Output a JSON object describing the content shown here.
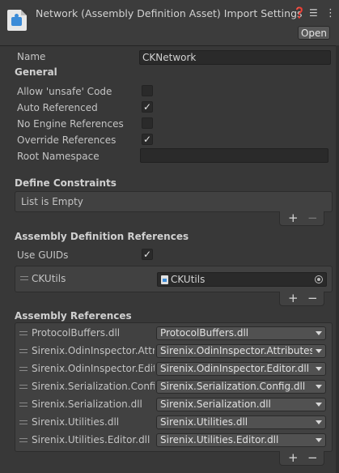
{
  "header": {
    "title": "Network (Assembly Definition Asset) Import Settings",
    "help_icon": "help-icon",
    "settings_icon": "settings-slider-icon",
    "more_icon": "more-vertical-icon",
    "open_label": "Open"
  },
  "name": {
    "label": "Name",
    "value": "CKNetwork"
  },
  "general": {
    "heading": "General",
    "allow_unsafe": {
      "label": "Allow 'unsafe' Code",
      "checked": false
    },
    "auto_referenced": {
      "label": "Auto Referenced",
      "checked": true
    },
    "no_engine_refs": {
      "label": "No Engine References",
      "checked": false
    },
    "override_refs": {
      "label": "Override References",
      "checked": true
    },
    "root_namespace": {
      "label": "Root Namespace",
      "value": ""
    }
  },
  "define_constraints": {
    "heading": "Define Constraints",
    "empty_text": "List is Empty",
    "add_label": "+",
    "remove_label": "−"
  },
  "assembly_definition_refs": {
    "heading": "Assembly Definition References",
    "use_guids": {
      "label": "Use GUIDs",
      "checked": true
    },
    "items": [
      {
        "label": "CKUtils",
        "value": "CKUtils"
      }
    ],
    "add_label": "+",
    "remove_label": "−"
  },
  "assembly_refs": {
    "heading": "Assembly References",
    "items": [
      {
        "label": "ProtocolBuffers.dll",
        "value": "ProtocolBuffers.dll"
      },
      {
        "label": "Sirenix.OdinInspector.Attributes.dll",
        "value": "Sirenix.OdinInspector.Attributes.dll"
      },
      {
        "label": "Sirenix.OdinInspector.Editor.dll",
        "value": "Sirenix.OdinInspector.Editor.dll"
      },
      {
        "label": "Sirenix.Serialization.Config.dll",
        "value": "Sirenix.Serialization.Config.dll"
      },
      {
        "label": "Sirenix.Serialization.dll",
        "value": "Sirenix.Serialization.dll"
      },
      {
        "label": "Sirenix.Utilities.dll",
        "value": "Sirenix.Utilities.dll"
      },
      {
        "label": "Sirenix.Utilities.Editor.dll",
        "value": "Sirenix.Utilities.Editor.dll"
      }
    ],
    "add_label": "+",
    "remove_label": "−"
  },
  "check_glyph": "✓"
}
